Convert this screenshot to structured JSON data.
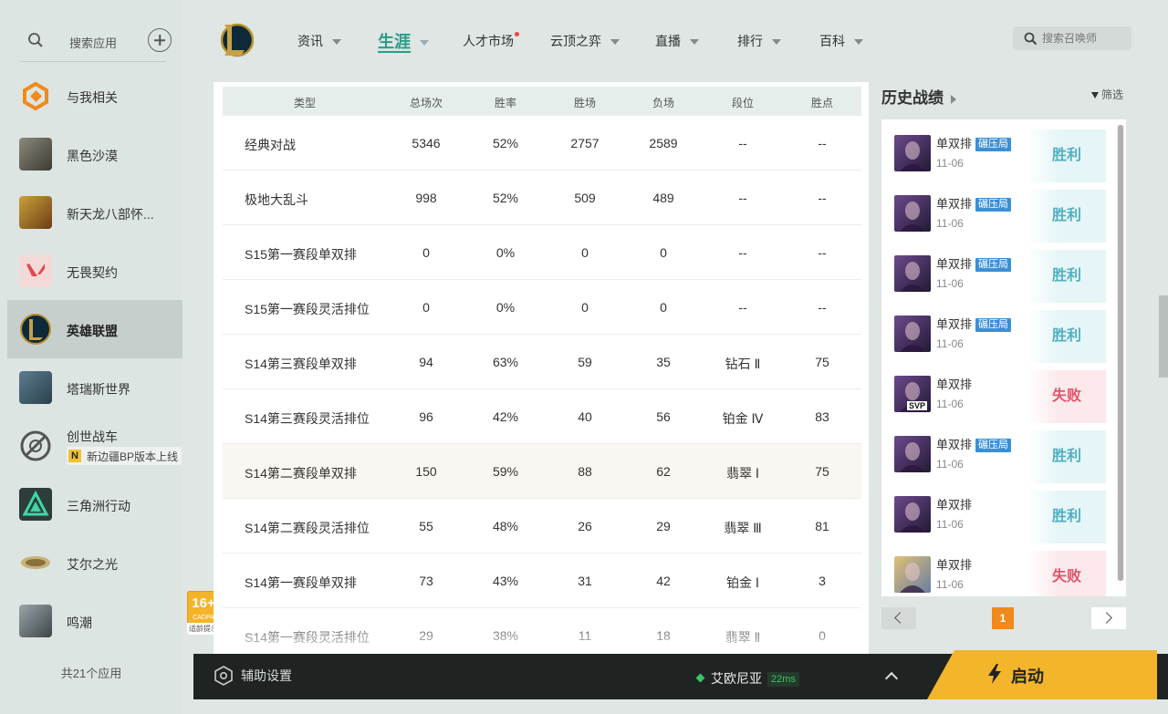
{
  "sidebar": {
    "search_label": "搜索应用",
    "games": [
      {
        "name": "与我相关"
      },
      {
        "name": "黑色沙漠"
      },
      {
        "name": "新天龙八部怀..."
      },
      {
        "name": "无畏契约"
      },
      {
        "name": "英雄联盟"
      },
      {
        "name": "塔瑞斯世界"
      },
      {
        "name": "创世战车",
        "sub": "新边疆BP版本上线",
        "sub_badge": "N"
      },
      {
        "name": "三角洲行动"
      },
      {
        "name": "艾尔之光"
      },
      {
        "name": "鸣潮"
      }
    ],
    "footer": "共21个应用"
  },
  "age_rating": {
    "age": "16+",
    "org": "CADPA",
    "tip": "适龄提示"
  },
  "nav": {
    "items": [
      {
        "label": "资讯"
      },
      {
        "label": "生涯"
      },
      {
        "label": "人才市场"
      },
      {
        "label": "云顶之弈"
      },
      {
        "label": "直播"
      },
      {
        "label": "排行"
      },
      {
        "label": "百科"
      }
    ],
    "search_placeholder": "搜索召唤师"
  },
  "table": {
    "headers": [
      "类型",
      "总场次",
      "胜率",
      "胜场",
      "负场",
      "段位",
      "胜点"
    ],
    "rows": [
      [
        "经典对战",
        "5346",
        "52%",
        "2757",
        "2589",
        "--",
        "--"
      ],
      [
        "极地大乱斗",
        "998",
        "52%",
        "509",
        "489",
        "--",
        "--"
      ],
      [
        "S15第一赛段单双排",
        "0",
        "0%",
        "0",
        "0",
        "--",
        "--"
      ],
      [
        "S15第一赛段灵活排位",
        "0",
        "0%",
        "0",
        "0",
        "--",
        "--"
      ],
      [
        "S14第三赛段单双排",
        "94",
        "63%",
        "59",
        "35",
        "钻石 Ⅱ",
        "75"
      ],
      [
        "S14第三赛段灵活排位",
        "96",
        "42%",
        "40",
        "56",
        "铂金 Ⅳ",
        "83"
      ],
      [
        "S14第二赛段单双排",
        "150",
        "59%",
        "88",
        "62",
        "翡翠 Ⅰ",
        "75"
      ],
      [
        "S14第二赛段灵活排位",
        "55",
        "48%",
        "26",
        "29",
        "翡翠 Ⅲ",
        "81"
      ],
      [
        "S14第一赛段单双排",
        "73",
        "43%",
        "31",
        "42",
        "铂金 Ⅰ",
        "3"
      ],
      [
        "S14第一赛段灵活排位",
        "29",
        "38%",
        "11",
        "18",
        "翡翠 Ⅱ",
        "0"
      ]
    ]
  },
  "history": {
    "title": "历史战绩",
    "filter_label": "筛选",
    "items": [
      {
        "mode": "单双排",
        "tag": "碾压局",
        "date": "11-06",
        "result": "胜利",
        "win": true
      },
      {
        "mode": "单双排",
        "tag": "碾压局",
        "date": "11-06",
        "result": "胜利",
        "win": true
      },
      {
        "mode": "单双排",
        "tag": "碾压局",
        "date": "11-06",
        "result": "胜利",
        "win": true
      },
      {
        "mode": "单双排",
        "tag": "碾压局",
        "date": "11-06",
        "result": "胜利",
        "win": true
      },
      {
        "mode": "单双排",
        "tag": "",
        "date": "11-06",
        "result": "失败",
        "win": false,
        "badge": "SVP"
      },
      {
        "mode": "单双排",
        "tag": "碾压局",
        "date": "11-06",
        "result": "胜利",
        "win": true
      },
      {
        "mode": "单双排",
        "tag": "",
        "date": "11-06",
        "result": "胜利",
        "win": true
      },
      {
        "mode": "单双排",
        "tag": "",
        "date": "11-06",
        "result": "失败",
        "win": false
      }
    ],
    "current_page": "1"
  },
  "bottom": {
    "assist_label": "辅助设置",
    "server": "艾欧尼亚",
    "ping": "22ms",
    "launch_label": "启动"
  },
  "colors": {
    "accent": "#2a9c88",
    "win": "#4fb0c0",
    "loss": "#e0556a",
    "launch": "#f3b52a",
    "tag": "#3a8fd6",
    "page_active": "#f08a1a"
  }
}
